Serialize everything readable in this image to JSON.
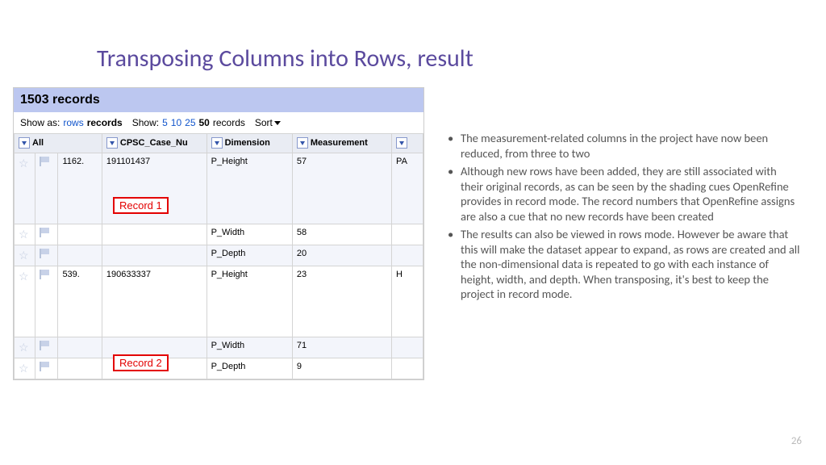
{
  "title": "Transposing Columns into Rows, result",
  "page_number": "26",
  "screenshot": {
    "record_count": "1503 records",
    "show_as_label": "Show as:",
    "show_as_rows": "rows",
    "show_as_records": "records",
    "show_label": "Show:",
    "show_5": "5",
    "show_10": "10",
    "show_25": "25",
    "show_50": "50",
    "show_records": "records",
    "sort": "Sort",
    "col_all": "All",
    "col_case": "CPSC_Case_Nu",
    "col_dim": "Dimension",
    "col_meas": "Measurement",
    "rows": [
      {
        "num": "1162.",
        "case": "191101437",
        "dim": "P_Height",
        "meas": "57",
        "extra": "PA",
        "cls": "tr-odd",
        "tall": true
      },
      {
        "num": "",
        "case": "",
        "dim": "P_Width",
        "meas": "58",
        "extra": "",
        "cls": "tr-even",
        "tall": false
      },
      {
        "num": "",
        "case": "",
        "dim": "P_Depth",
        "meas": "20",
        "extra": "",
        "cls": "tr-odd",
        "tall": false
      },
      {
        "num": "539.",
        "case": "190633337",
        "dim": "P_Height",
        "meas": "23",
        "extra": "H",
        "cls": "tr-even",
        "tall": true
      },
      {
        "num": "",
        "case": "",
        "dim": "P_Width",
        "meas": "71",
        "extra": "",
        "cls": "tr-odd",
        "tall": false
      },
      {
        "num": "",
        "case": "",
        "dim": "P_Depth",
        "meas": "9",
        "extra": "",
        "cls": "tr-even",
        "tall": false
      }
    ]
  },
  "callout1": "Record 1",
  "callout2": "Record 2",
  "bullets": [
    "The measurement-related columns in the project have now been reduced, from three to two",
    "Although new rows have been added, they are still associated with their original records, as can be seen by the shading cues OpenRefine provides in record mode. The record numbers that OpenRefine assigns are also a cue that no new records have been created",
    "The results can also be viewed in rows mode. However be aware that this will make the dataset appear to expand, as rows are created and all the non-dimensional data is repeated to go with each instance of height, width, and depth. When transposing, it's best to keep the project in record mode."
  ]
}
